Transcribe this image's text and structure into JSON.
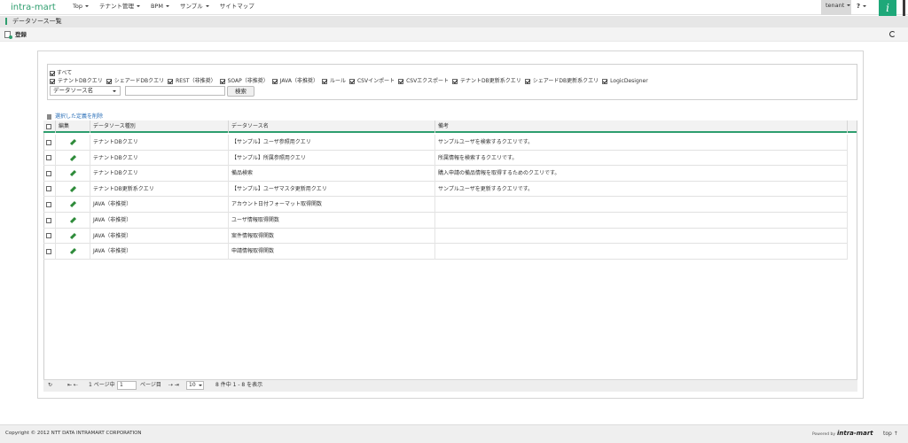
{
  "brand": "intra-mart",
  "nav": [
    {
      "label": "Top"
    },
    {
      "label": "テナント管理"
    },
    {
      "label": "BPM"
    },
    {
      "label": "サンプル"
    },
    {
      "label": "サイトマップ",
      "no_caret": true
    }
  ],
  "user": "tenant",
  "help": "?",
  "info_icon": "i",
  "page_title": "データソース一覧",
  "action_register": "登録",
  "filter": {
    "all_label": "すべて",
    "options": [
      "テナントDBクエリ",
      "シェアードDBクエリ",
      "REST（非推奨）",
      "SOAP（非推奨）",
      "JAVA（非推奨）",
      "ルール",
      "CSVインポート",
      "CSVエクスポート",
      "テナントDB更新系クエリ",
      "シェアードDB更新系クエリ",
      "LogicDesigner"
    ],
    "select_value": "データソース名",
    "search_value": "",
    "search_button": "検索"
  },
  "delete_link": "選択した定義を削除",
  "grid": {
    "headers": [
      "編集",
      "データソース種別",
      "データソース名",
      "備考"
    ],
    "rows": [
      [
        "テナントDBクエリ",
        "【サンプル】ユーザ参照用クエリ",
        "サンプルユーザを検索するクエリです。"
      ],
      [
        "テナントDBクエリ",
        "【サンプル】所属参照用クエリ",
        "所属情報を検索するクエリです。"
      ],
      [
        "テナントDBクエリ",
        "備品検索",
        "購入申請の備品情報を取得するためのクエリです。"
      ],
      [
        "テナントDB更新系クエリ",
        "【サンプル】ユーザマスタ更新用クエリ",
        "サンプルユーザを更新するクエリです。"
      ],
      [
        "JAVA（非推奨）",
        "アカウント日付フォーマット取得関数",
        ""
      ],
      [
        "JAVA（非推奨）",
        "ユーザ情報取得関数",
        ""
      ],
      [
        "JAVA（非推奨）",
        "案件情報取得関数",
        ""
      ],
      [
        "JAVA（非推奨）",
        "申請情報取得関数",
        ""
      ]
    ]
  },
  "pager": {
    "refresh": "↻",
    "first_prev": "⇤ ⇠",
    "page_of_prefix": "1 ページ中",
    "page_value": "1",
    "page_suffix": "ページ目",
    "next_last": "⇢ ⇥",
    "per_page": "10",
    "summary": "8 件中 1 - 8 を表示"
  },
  "footer": {
    "copyright": "Copyright © 2012 NTT DATA INTRAMART CORPORATION",
    "powered_by": "Powered by",
    "logo": "intra-mart",
    "top_link": "top ↑"
  }
}
